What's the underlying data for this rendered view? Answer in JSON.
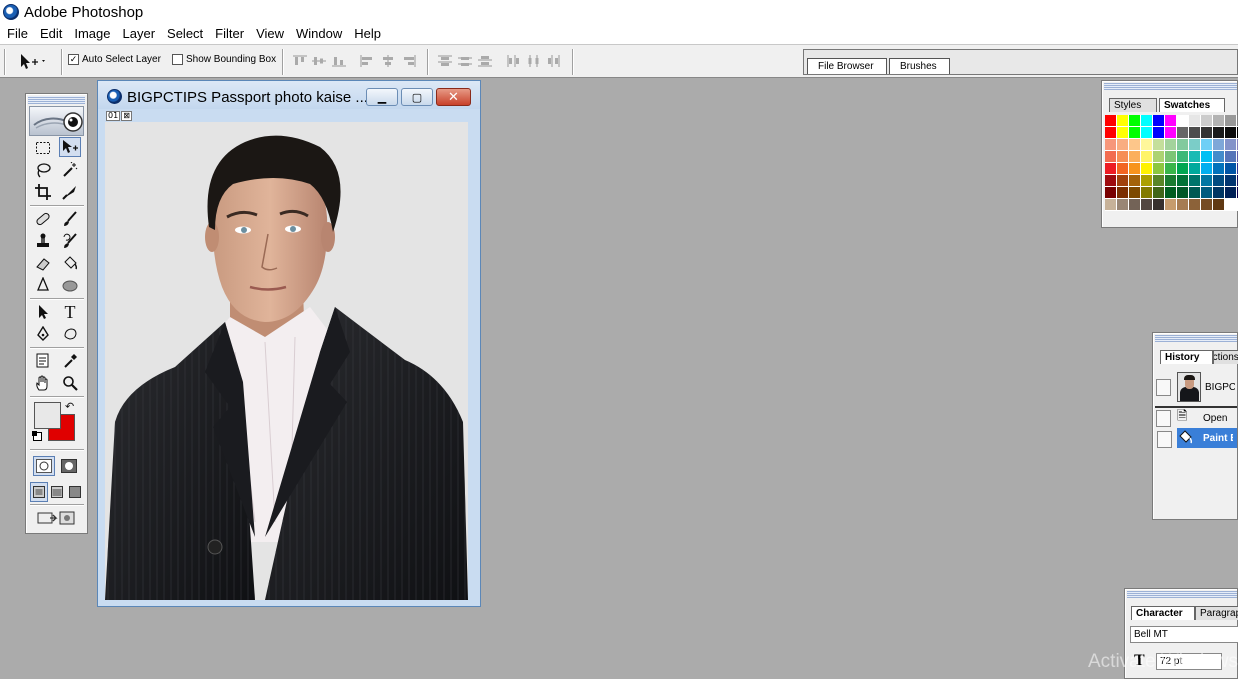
{
  "app": {
    "title": "Adobe Photoshop"
  },
  "menu": [
    "File",
    "Edit",
    "Image",
    "Layer",
    "Select",
    "Filter",
    "View",
    "Window",
    "Help"
  ],
  "options_bar": {
    "auto_select_layer": {
      "label": "Auto Select Layer",
      "checked": true,
      "check_mark": "✓"
    },
    "show_bounding_box": {
      "label": "Show Bounding Box",
      "checked": false
    }
  },
  "palette_well": {
    "tabs": [
      "File Browser",
      "Brushes"
    ]
  },
  "toolbox": {
    "tools": [
      "rectangular-marquee",
      "move",
      "lasso",
      "magic-wand",
      "crop",
      "slice",
      "healing-brush",
      "brush",
      "clone-stamp",
      "history-brush",
      "eraser",
      "paint-bucket",
      "blur",
      "dodge",
      "path-selection",
      "type",
      "pen",
      "custom-shape",
      "notes",
      "eyedropper",
      "hand",
      "zoom"
    ],
    "type_tool_glyph": "T",
    "foreground_color": "#e8e8e8",
    "background_color": "#e00000"
  },
  "document": {
    "title": "BIGPCTIPS Passport photo kaise ...",
    "min_glyph": "▁",
    "max_glyph": "▢",
    "close_glyph": "✕",
    "zoom_indicators": [
      "01",
      "⊠"
    ]
  },
  "swatches_panel": {
    "tabs": [
      "Styles",
      "Swatches"
    ],
    "active_tab": "Swatches",
    "colors": [
      "#ff0000",
      "#ffff00",
      "#00ff00",
      "#00ffff",
      "#0000ff",
      "#ff00ff",
      "#ffffff",
      "#e6e6e6",
      "#cccccc",
      "#b3b3b3",
      "#999999",
      "#808080",
      "#ff0000",
      "#ffff00",
      "#00ff00",
      "#00ffff",
      "#0000ff",
      "#ff00ff",
      "#666666",
      "#4d4d4d",
      "#333333",
      "#1a1a1a",
      "#0d0d0d",
      "#000000",
      "#f7977a",
      "#f9ad81",
      "#fdc68a",
      "#fff79a",
      "#c4df9b",
      "#a3d39c",
      "#82ca9d",
      "#7bcdc8",
      "#6ecff6",
      "#7ea7d8",
      "#8493ca",
      "#8882be",
      "#f26c4f",
      "#f68e55",
      "#fbaf5c",
      "#fff467",
      "#acd372",
      "#7cc576",
      "#3bb878",
      "#1abbb4",
      "#00bff3",
      "#438ccb",
      "#5574b9",
      "#605ca8",
      "#ed1c24",
      "#f26522",
      "#f7941d",
      "#fff200",
      "#8dc73f",
      "#39b54a",
      "#00a651",
      "#00a99d",
      "#00aeef",
      "#0072bc",
      "#0054a6",
      "#2e3192",
      "#9e0b0f",
      "#a0410d",
      "#a3620a",
      "#aba000",
      "#598527",
      "#197b30",
      "#007236",
      "#00746b",
      "#0076a3",
      "#004a80",
      "#003471",
      "#1b1464",
      "#790000",
      "#7b2e00",
      "#7d4900",
      "#827b00",
      "#406618",
      "#005e20",
      "#005826",
      "#005952",
      "#005b7f",
      "#003663",
      "#002157",
      "#0d004c",
      "#c7b299",
      "#998675",
      "#736357",
      "#534741",
      "#37302d",
      "#c69c6d",
      "#a67c52",
      "#8c6239",
      "#754c24",
      "#603913",
      "#ffffff",
      "#ffffff"
    ]
  },
  "history_panel": {
    "tabs": [
      "History",
      "Actions"
    ],
    "active_tab": "History",
    "snapshot": "BIGPCTIPS Passport photo kaise banaye",
    "states": [
      "Open",
      "Paint Bucket"
    ],
    "selected_state": "Paint Bucket"
  },
  "character_panel": {
    "tabs": [
      "Character",
      "Paragraph"
    ],
    "active_tab": "Character",
    "font_family": "Bell MT",
    "font_size": "72 pt",
    "size_glyph": "T"
  },
  "watermark": "Activate Windows"
}
